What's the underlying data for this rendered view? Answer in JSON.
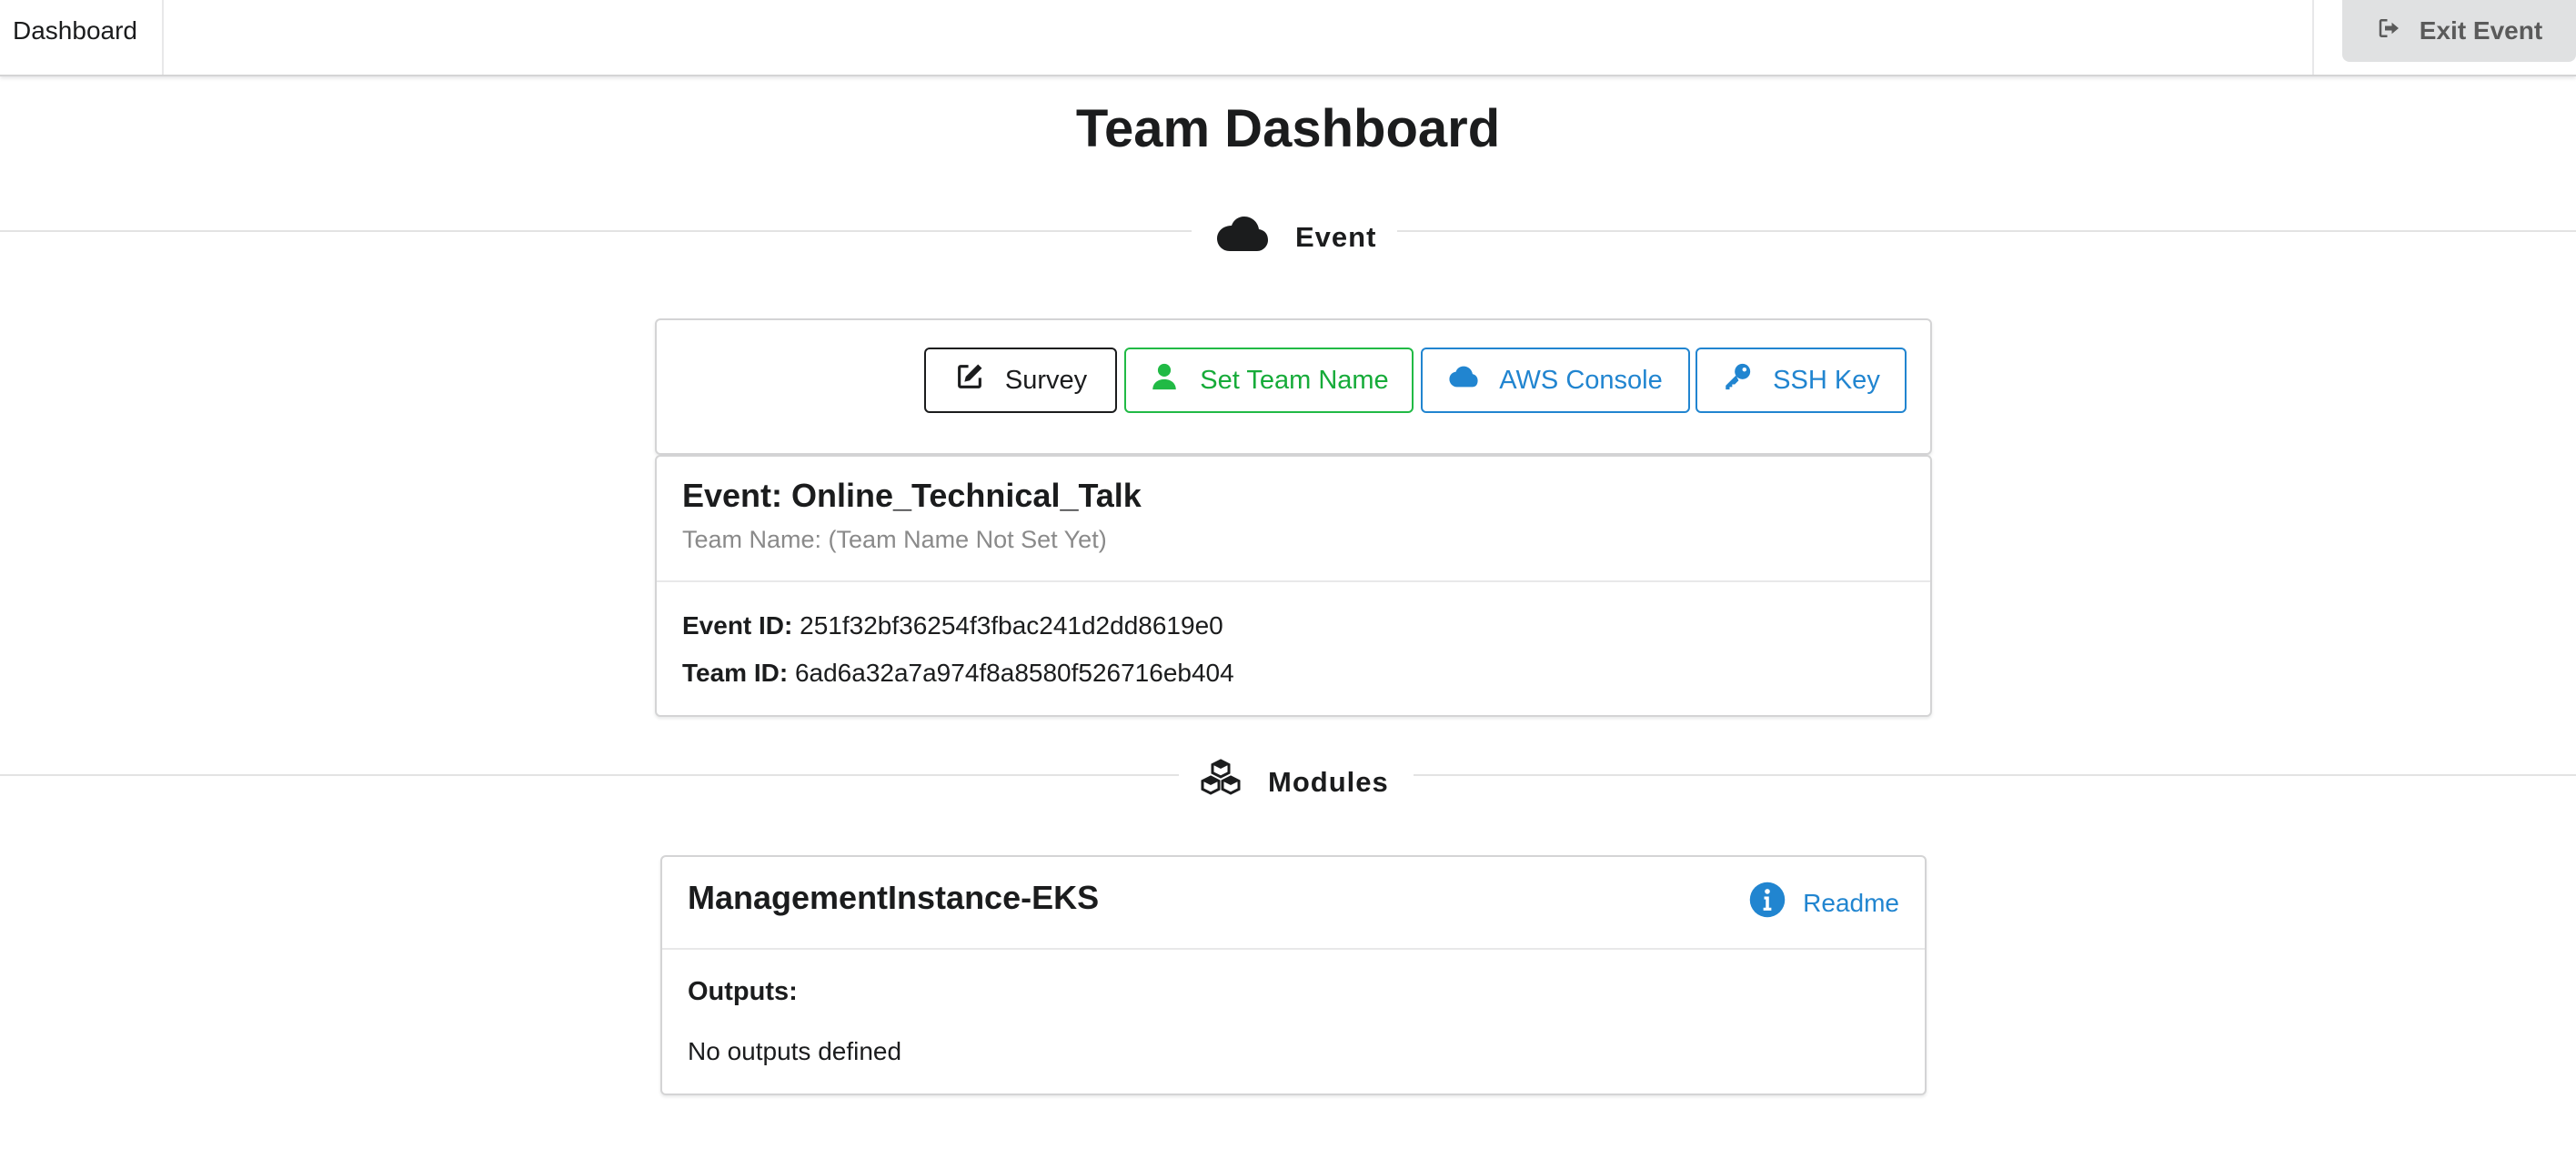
{
  "topbar": {
    "brand": "Dashboard",
    "exit_label": "Exit Event"
  },
  "page": {
    "title": "Team Dashboard"
  },
  "sections": {
    "event": "Event",
    "modules": "Modules"
  },
  "actions": {
    "survey": "Survey",
    "set_team_name": "Set Team Name",
    "aws_console": "AWS Console",
    "ssh_key": "SSH Key"
  },
  "event": {
    "title": "Event: Online_Technical_Talk",
    "team_name": "Team Name: (Team Name Not Set Yet)",
    "event_id_label": "Event ID:",
    "event_id_value": "251f32bf36254f3fbac241d2dd8619e0",
    "team_id_label": "Team ID:",
    "team_id_value": "6ad6a32a7a974f8a8580f526716eb404"
  },
  "module": {
    "name": "ManagementInstance-EKS",
    "readme_label": "Readme",
    "outputs_label": "Outputs:",
    "outputs_empty": "No outputs defined"
  },
  "icons": {
    "exit": "sign-out-icon",
    "event_section": "cloud-icon",
    "modules_section": "cubes-icon",
    "survey": "edit-icon",
    "set_team_name": "user-icon",
    "aws_console": "cloud-icon",
    "ssh_key": "key-icon",
    "readme": "info-circle-icon"
  },
  "colors": {
    "green": "#21ba45",
    "blue": "#2185d0",
    "dark": "#1b1c1d",
    "muted": "#8a8a8a"
  }
}
